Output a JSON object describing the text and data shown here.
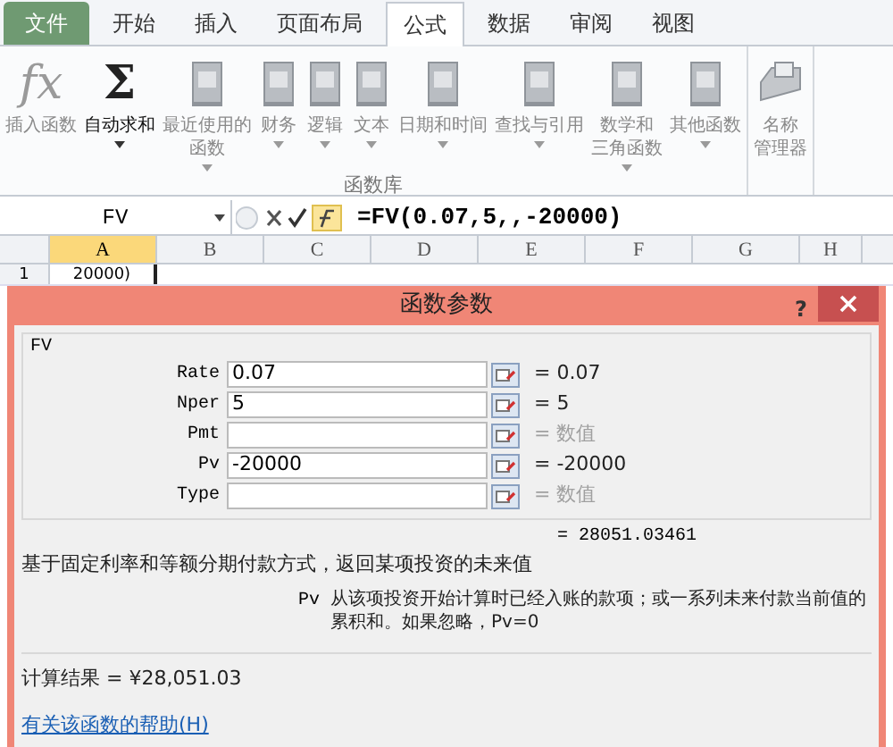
{
  "ribbon_tabs": [
    {
      "label": "文件",
      "kind": "file",
      "selected": false
    },
    {
      "label": "开始",
      "kind": "tab",
      "selected": false
    },
    {
      "label": "插入",
      "kind": "tab",
      "selected": false
    },
    {
      "label": "页面布局",
      "kind": "tab",
      "selected": false
    },
    {
      "label": "公式",
      "kind": "tab",
      "selected": true
    },
    {
      "label": "数据",
      "kind": "tab",
      "selected": false
    },
    {
      "label": "审阅",
      "kind": "tab",
      "selected": false
    },
    {
      "label": "视图",
      "kind": "tab",
      "selected": false
    }
  ],
  "ribbon_groups": [
    {
      "label": "函数库",
      "items": [
        {
          "label": "插入函数",
          "kind": "glyph",
          "glyph": "fx",
          "disabled": true,
          "dropdown": false
        },
        {
          "label": "自动求和",
          "kind": "glyph",
          "glyph": "Σ",
          "disabled": false,
          "dropdown": true
        },
        {
          "label": "最近使用的",
          "label_2": "函数",
          "kind": "book",
          "disabled": true,
          "dropdown": true
        },
        {
          "label": "财务",
          "kind": "book",
          "disabled": true,
          "dropdown": true
        },
        {
          "label": "逻辑",
          "kind": "book",
          "disabled": true,
          "dropdown": true
        },
        {
          "label": "文本",
          "kind": "book",
          "disabled": true,
          "dropdown": true
        },
        {
          "label": "日期和时间",
          "kind": "book",
          "disabled": true,
          "dropdown": true
        },
        {
          "label": "查找与引用",
          "kind": "book",
          "disabled": true,
          "dropdown": true
        },
        {
          "label": "数学和",
          "label_2": "三角函数",
          "kind": "book",
          "disabled": true,
          "dropdown": true
        },
        {
          "label": "其他函数",
          "kind": "book",
          "disabled": true,
          "dropdown": true
        }
      ]
    },
    {
      "items": [
        {
          "label": "名称",
          "label_2": "管理器",
          "kind": "tray",
          "disabled": true,
          "dropdown": false
        }
      ]
    }
  ],
  "formula_bar": {
    "name_box": "FV",
    "formula": "=FV(0.07,5,,-20000)"
  },
  "columns": [
    {
      "label": "A",
      "selected": true
    },
    {
      "label": "B",
      "selected": false
    },
    {
      "label": "C",
      "selected": false
    },
    {
      "label": "D",
      "selected": false
    },
    {
      "label": "E",
      "selected": false
    },
    {
      "label": "F",
      "selected": false
    },
    {
      "label": "G",
      "selected": false
    },
    {
      "label": "H",
      "selected": false
    }
  ],
  "rows": [
    {
      "label": "1",
      "cells": [
        "20000)"
      ]
    }
  ],
  "dialog": {
    "title": "函数参数",
    "help": "?",
    "function_name": "FV",
    "arguments": [
      {
        "label": "Rate",
        "value": "0.07",
        "result": "= 0.07",
        "muted": false
      },
      {
        "label": "Nper",
        "value": "5",
        "result": "= 5",
        "muted": false
      },
      {
        "label": "Pmt",
        "result": "= 数值",
        "muted": true
      },
      {
        "label": "Pv",
        "value": "-20000",
        "result": "= -20000",
        "muted": false
      },
      {
        "label": "Type",
        "result": "= 数值",
        "muted": true
      }
    ],
    "formula_result": "= 28051.03461",
    "description": "基于固定利率和等额分期付款方式，返回某项投资的未来值",
    "argument_name": "Pv",
    "argument_help": "从该项投资开始计算时已经入账的款项；或一系列未来付款当前值的累积和。如果忽略，Pv=0",
    "calc_result": "计算结果 = ¥28,051.03",
    "help_link": "有关该函数的帮助(H)"
  }
}
